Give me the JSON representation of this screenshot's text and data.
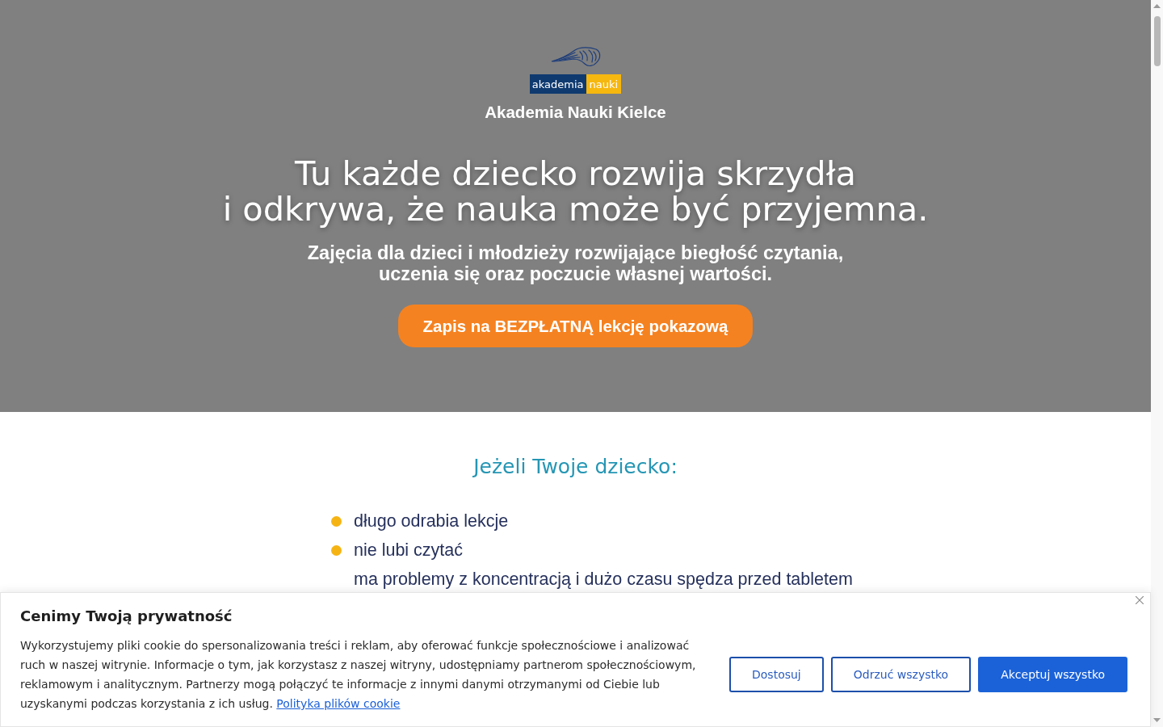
{
  "hero": {
    "logo": {
      "words": [
        "akademia",
        "nauki"
      ]
    },
    "brand": "Akademia Nauki Kielce",
    "headline": [
      "Tu każde dziecko rozwija skrzydła",
      "i odkrywa, że nauka może być przyjemna."
    ],
    "subheadline": [
      "Zajęcia dla dzieci i młodzieży rozwijające biegłość czytania,",
      "uczenia się oraz poczucie własnej wartości."
    ],
    "cta": "Zapis na BEZPŁATNĄ lekcję pokazową"
  },
  "problems": {
    "title": "Jeżeli Twoje dziecko:",
    "items": [
      {
        "text": "długo odrabia lekcje",
        "marker": true
      },
      {
        "text": "nie lubi czytać",
        "marker": true
      },
      {
        "text": "ma problemy z koncentracją i dużo czasu spędza przed tabletem",
        "marker": false
      }
    ]
  },
  "cookie_banner": {
    "title": "Cenimy Twoją prywatność",
    "text": "Wykorzystujemy pliki cookie do spersonalizowania treści i reklam, aby oferować funkcje społecznościowe i analizować ruch w naszej witrynie. Informacje o tym, jak korzystasz z naszej witryny, udostępniamy partnerom społecznościowym, reklamowym i analitycznym. Partnerzy mogą połączyć te informacje z innymi danymi otrzymanymi od Ciebie lub uzyskanymi podczas korzystania z ich usług.",
    "link": "Polityka plików cookie",
    "buttons": [
      {
        "label": "Dostosuj",
        "kind": "outline"
      },
      {
        "label": "Odrzuć wszystko",
        "kind": "outline"
      },
      {
        "label": "Akceptuj wszystko",
        "kind": "primary"
      }
    ]
  }
}
